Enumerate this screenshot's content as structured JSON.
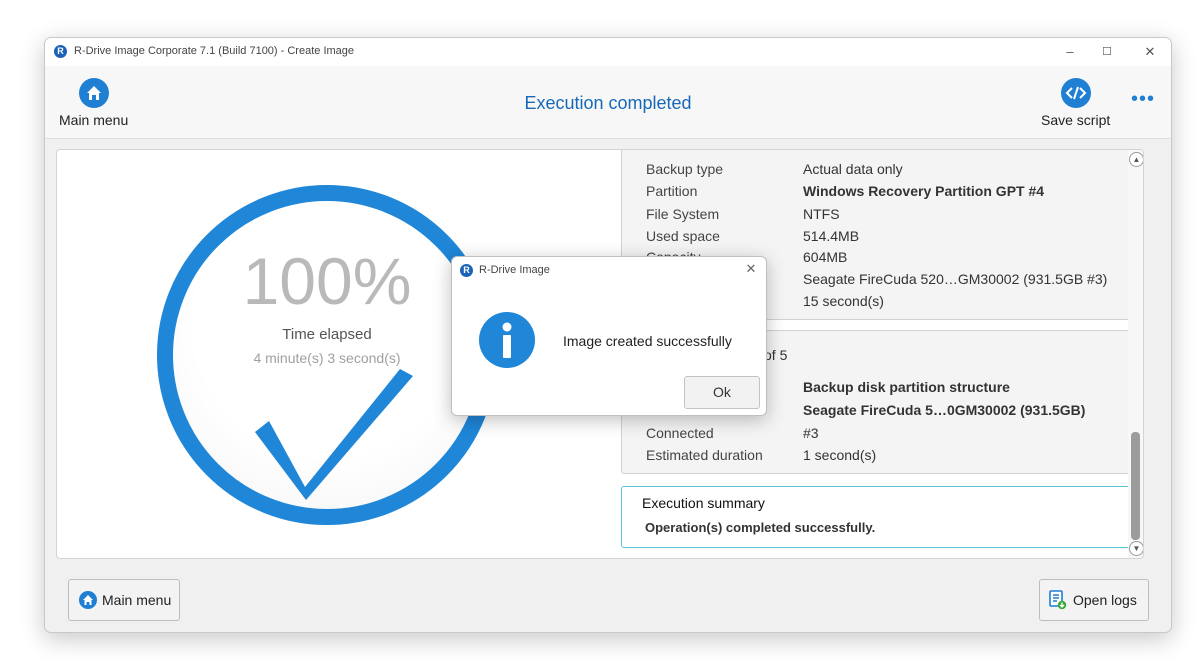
{
  "window": {
    "title": "R-Drive Image Corporate 7.1 (Build 7100) - Create Image",
    "controls": {
      "minimize": "–",
      "maximize": "☐",
      "close": "✕"
    }
  },
  "toolbar": {
    "main_menu_label": "Main menu",
    "heading": "Execution completed",
    "save_script_label": "Save script",
    "more": "•••"
  },
  "progress": {
    "percent": "100%",
    "elapsed_label": "Time elapsed",
    "elapsed_value": "4 minute(s) 3 second(s)"
  },
  "details_card": {
    "rows": [
      {
        "key": "Backup type",
        "value": "Actual data only"
      },
      {
        "key": "Partition",
        "value": "Windows Recovery Partition GPT #4"
      },
      {
        "key": "File System",
        "value": "NTFS"
      },
      {
        "key": "Used space",
        "value": "514.4MB"
      },
      {
        "key": "Capacity",
        "value": "604MB"
      },
      {
        "key": "",
        "value": "Seagate FireCuda 520…GM30002 (931.5GB #3)"
      },
      {
        "key": "",
        "value": "15 second(s)"
      }
    ]
  },
  "step_card": {
    "heading_fragment": "of 5",
    "rows": [
      {
        "key": "",
        "value": "Backup disk partition structure"
      },
      {
        "key": "",
        "value": "Seagate FireCuda 5…0GM30002 (931.5GB)"
      },
      {
        "key": "Connected",
        "value": "#3"
      },
      {
        "key": "Estimated duration",
        "value": "1 second(s)"
      }
    ]
  },
  "summary": {
    "title": "Execution summary",
    "text": "Operation(s) completed successfully."
  },
  "footer": {
    "main_menu_label": "Main menu",
    "open_logs_label": "Open logs"
  },
  "dialog": {
    "title": "R-Drive Image",
    "message": "Image created successfully",
    "ok_label": "Ok",
    "close": "✕"
  },
  "colors": {
    "accent": "#1f86d8",
    "heading": "#1769b8",
    "summary_border": "#5bc7d9"
  }
}
